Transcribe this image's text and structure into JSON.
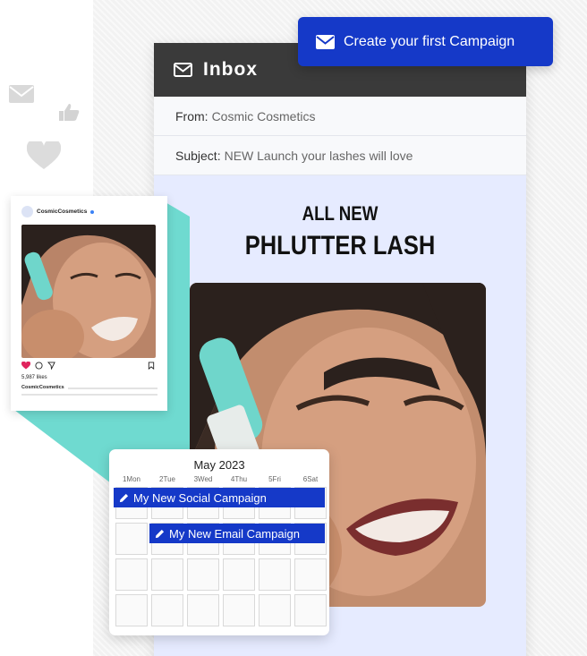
{
  "cta": {
    "label": "Create your first Campaign",
    "icon": "mail-icon"
  },
  "email": {
    "header_title": "Inbox",
    "from_label": "From:",
    "from_value": "Cosmic Cosmetics",
    "subject_label": "Subject:",
    "subject_value": "NEW Launch your lashes will love",
    "headline_line1": "ALL NEW",
    "headline_line2": "PHLUTTER LASH"
  },
  "social_post": {
    "username": "CosmicCosmetics",
    "likes": "5,987 likes",
    "caption_user": "CosmicCosmetics"
  },
  "calendar": {
    "month": "May 2023",
    "days": [
      "1Mon",
      "2Tue",
      "3Wed",
      "4Thu",
      "5Fri",
      "6Sat"
    ],
    "events": [
      {
        "label": "My New Social Campaign",
        "icon": "pencil-icon"
      },
      {
        "label": "My New Email Campaign",
        "icon": "pencil-icon"
      }
    ]
  },
  "colors": {
    "accent": "#1539c8",
    "teal": "#6fdad0",
    "email_body": "#e6ebff",
    "header_dark": "#3a3a3a"
  }
}
